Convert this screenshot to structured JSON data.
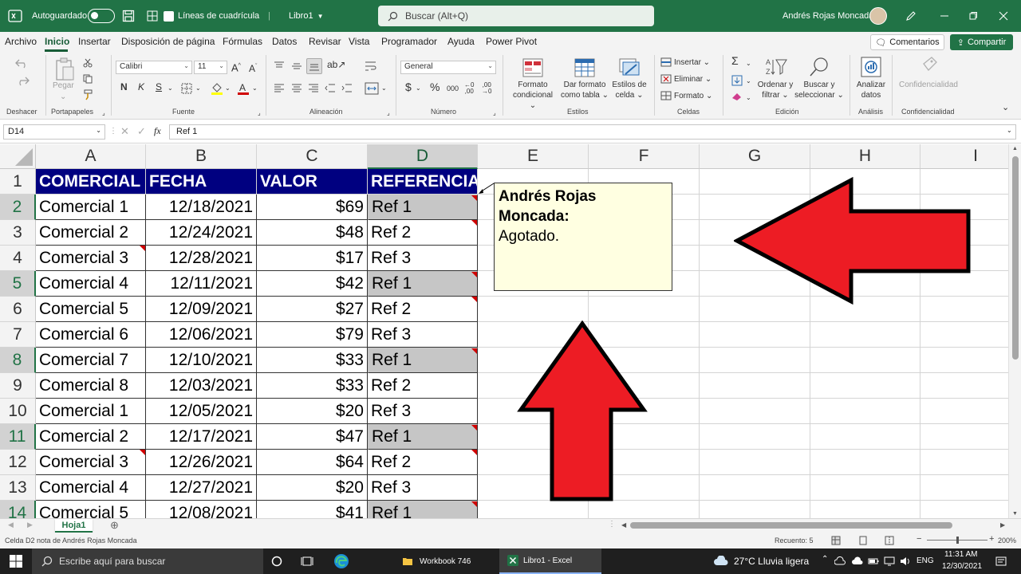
{
  "titlebar": {
    "autosave_label": "Autoguardado",
    "gridlines_label": "Líneas de cuadrícula",
    "workbook_name": "Libro1",
    "search_placeholder": "Buscar (Alt+Q)",
    "user_name": "Andrés Rojas Moncada"
  },
  "menu": {
    "items": [
      "Archivo",
      "Inicio",
      "Insertar",
      "Disposición de página",
      "Fórmulas",
      "Datos",
      "Revisar",
      "Vista",
      "Programador",
      "Ayuda",
      "Power Pivot"
    ],
    "active": "Inicio",
    "comments_label": "Comentarios",
    "share_label": "Compartir"
  },
  "ribbon": {
    "groups": [
      "Deshacer",
      "Portapapeles",
      "Fuente",
      "Alineación",
      "Número",
      "Estilos",
      "Celdas",
      "Edición",
      "Análisis",
      "Confidencialidad"
    ],
    "paste_label": "Pegar",
    "font_name": "Calibri",
    "font_size": "11",
    "number_format": "General",
    "cond_format_l1": "Formato",
    "cond_format_l2": "condicional",
    "table_format_l1": "Dar formato",
    "table_format_l2": "como tabla",
    "cell_styles_l1": "Estilos de",
    "cell_styles_l2": "celda",
    "insert_label": "Insertar",
    "delete_label": "Eliminar",
    "format_label": "Formato",
    "sort_l1": "Ordenar y",
    "sort_l2": "filtrar",
    "find_l1": "Buscar y",
    "find_l2": "seleccionar",
    "analyze_l1": "Analizar",
    "analyze_l2": "datos",
    "sensitivity_label": "Confidencialidad"
  },
  "formula_bar": {
    "name_box": "D14",
    "fx": "fx",
    "content": "Ref 1"
  },
  "grid": {
    "columns": [
      "A",
      "B",
      "C",
      "D",
      "E",
      "F",
      "G",
      "H",
      "I"
    ],
    "header_row": [
      "COMERCIAL",
      "FECHA",
      "VALOR",
      "REFERENCIA"
    ],
    "rows": [
      {
        "num": "2",
        "comercial": "Comercial 1",
        "fecha": "12/18/2021",
        "valor": "$69",
        "ref": "Ref 1"
      },
      {
        "num": "3",
        "comercial": "Comercial 2",
        "fecha": "12/24/2021",
        "valor": "$48",
        "ref": "Ref 2"
      },
      {
        "num": "4",
        "comercial": "Comercial 3",
        "fecha": "12/28/2021",
        "valor": "$17",
        "ref": "Ref 3"
      },
      {
        "num": "5",
        "comercial": "Comercial 4",
        "fecha": "12/11/2021",
        "valor": "$42",
        "ref": "Ref 1"
      },
      {
        "num": "6",
        "comercial": "Comercial 5",
        "fecha": "12/09/2021",
        "valor": "$27",
        "ref": "Ref 2"
      },
      {
        "num": "7",
        "comercial": "Comercial 6",
        "fecha": "12/06/2021",
        "valor": "$79",
        "ref": "Ref 3"
      },
      {
        "num": "8",
        "comercial": "Comercial 7",
        "fecha": "12/10/2021",
        "valor": "$33",
        "ref": "Ref 1"
      },
      {
        "num": "9",
        "comercial": "Comercial 8",
        "fecha": "12/03/2021",
        "valor": "$33",
        "ref": "Ref 2"
      },
      {
        "num": "10",
        "comercial": "Comercial 1",
        "fecha": "12/05/2021",
        "valor": "$20",
        "ref": "Ref 3"
      },
      {
        "num": "11",
        "comercial": "Comercial 2",
        "fecha": "12/17/2021",
        "valor": "$47",
        "ref": "Ref 1"
      },
      {
        "num": "12",
        "comercial": "Comercial 3",
        "fecha": "12/26/2021",
        "valor": "$64",
        "ref": "Ref 2"
      },
      {
        "num": "13",
        "comercial": "Comercial 4",
        "fecha": "12/27/2021",
        "valor": "$20",
        "ref": "Ref 3"
      },
      {
        "num": "14",
        "comercial": "Comercial 5",
        "fecha": "12/08/2021",
        "valor": "$41",
        "ref": "Ref 1"
      }
    ],
    "header_row_num": "1"
  },
  "comment": {
    "author_line1": "Andrés Rojas",
    "author_line2": "Moncada:",
    "text": "Agotado."
  },
  "sheet_tabs": [
    "Hoja1"
  ],
  "status": {
    "left": "Celda D2 nota de Andrés Rojas Moncada",
    "count": "Recuento: 5",
    "zoom": "200%"
  },
  "taskbar": {
    "search_placeholder": "Escribe aquí para buscar",
    "app1": "Workbook 746",
    "app2": "Libro1 - Excel",
    "weather": "27°C  Lluvia ligera",
    "lang": "ENG",
    "time": "11:31 AM",
    "date": "12/30/2021"
  },
  "colors": {
    "excel_green": "#217346",
    "header_fill": "#000080",
    "comment_fill": "#ffffe1",
    "arrow_red": "#ed1c24",
    "note_red": "#d00000"
  }
}
